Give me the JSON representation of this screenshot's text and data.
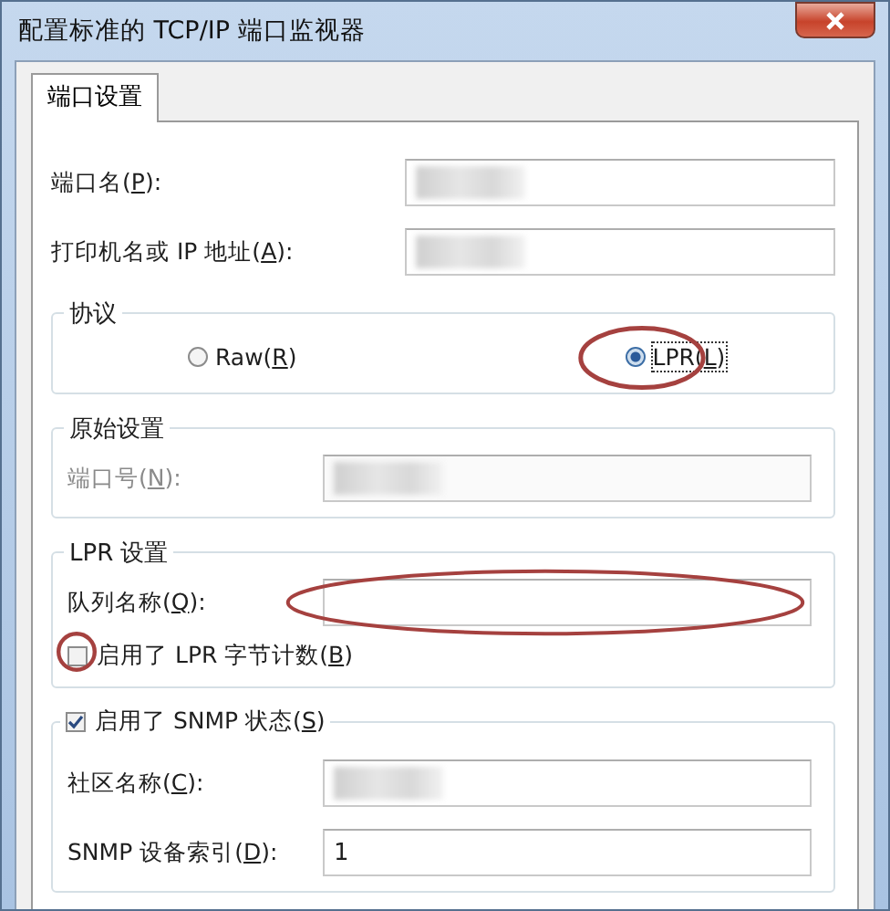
{
  "window": {
    "title": "配置标准的 TCP/IP 端口监视器"
  },
  "tabs": [
    {
      "label": "端口设置",
      "selected": true
    }
  ],
  "fields": [
    {
      "label": {
        "before": "端口名(",
        "key": "P",
        "after": "):"
      },
      "redacted": true
    },
    {
      "label": {
        "before": "打印机名或 IP 地址(",
        "key": "A",
        "after": "):"
      },
      "redacted": true
    }
  ],
  "protocol": {
    "title": "协议",
    "options": [
      {
        "label": {
          "before": "Raw(",
          "key": "R",
          "after": ")"
        },
        "selected": false,
        "circled": false
      },
      {
        "label": {
          "before": "LPR(",
          "key": "L",
          "after": ")"
        },
        "selected": true,
        "circled": true
      }
    ]
  },
  "raw_settings": {
    "title": "原始设置",
    "disabled": true,
    "fields": [
      {
        "label": {
          "before": "端口号(",
          "key": "N",
          "after": "):"
        },
        "redacted": true
      }
    ]
  },
  "lpr_settings": {
    "title": "LPR 设置",
    "fields": [
      {
        "label": {
          "before": "队列名称(",
          "key": "Q",
          "after": "):"
        },
        "circled": true
      }
    ],
    "checkbox": {
      "label": {
        "before": "启用了 LPR 字节计数(",
        "key": "B",
        "after": ")"
      },
      "checked": false,
      "circled": true
    }
  },
  "snmp": {
    "checkbox": {
      "label": {
        "before": "启用了 SNMP 状态(",
        "key": "S",
        "after": ")"
      },
      "checked": true
    },
    "fields": [
      {
        "label": {
          "before": "社区名称(",
          "key": "C",
          "after": "):"
        },
        "redacted": true
      },
      {
        "label": {
          "before": "SNMP 设备索引(",
          "key": "D",
          "after": "):"
        },
        "value": "1"
      }
    ]
  }
}
